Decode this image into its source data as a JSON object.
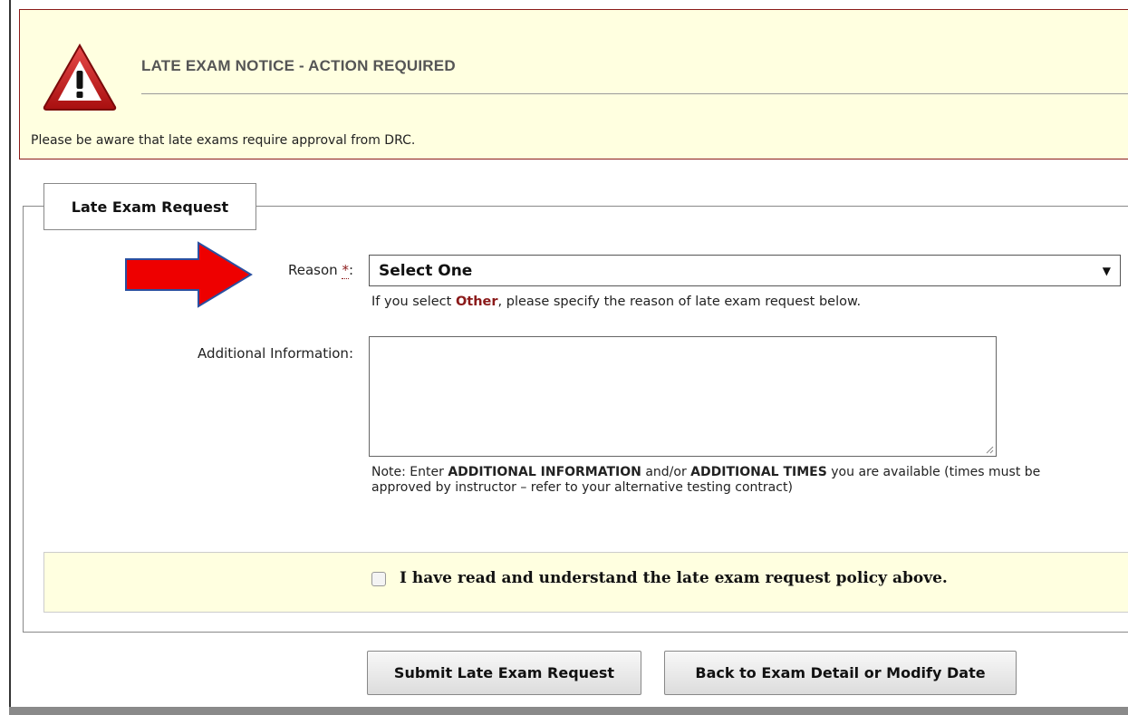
{
  "notice": {
    "title": "LATE EXAM NOTICE - ACTION REQUIRED",
    "message": "Please be aware that late exams require approval from DRC.",
    "icon": "warning-icon",
    "border_color": "#8b1a1a",
    "background": "#ffffe0"
  },
  "form": {
    "legend": "Late Exam Request",
    "reason": {
      "label": "Reason",
      "required_mark": "*",
      "label_suffix": ":",
      "selected": "Select One",
      "help_prefix": "If you select",
      "help_highlight": "Other",
      "help_suffix": ", please specify the reason of late exam request below."
    },
    "additional_info": {
      "label": "Additional Information:",
      "value": ""
    },
    "note": {
      "prefix": "Note: Enter",
      "bold1": "ADDITIONAL INFORMATION",
      "mid": "and/or",
      "bold2": "ADDITIONAL TIMES",
      "suffix": "you are available (times must be approved by instructor – refer to your alternative testing contract)"
    },
    "acknowledgement": {
      "checked": false,
      "label": "I have read and understand the late exam request policy above."
    }
  },
  "buttons": {
    "submit": "Submit Late Exam Request",
    "back": "Back to Exam Detail or Modify Date"
  },
  "annotation": {
    "arrow_color": "#ee0000",
    "arrow_outline": "#2a4fa0"
  }
}
